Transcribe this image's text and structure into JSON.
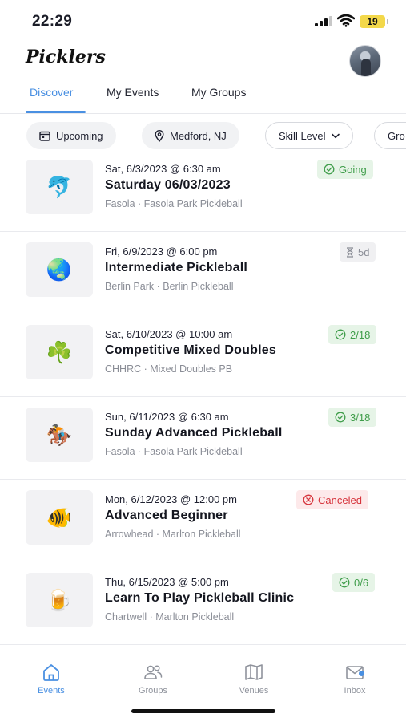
{
  "status_bar": {
    "time": "22:29",
    "battery": "19",
    "icons": [
      "signal-icon",
      "wifi-icon",
      "battery-icon"
    ],
    "battery_color": "#f3d84a"
  },
  "header": {
    "title": "Picklers",
    "avatar": "user-avatar"
  },
  "tabs": [
    {
      "label": "Discover",
      "active": true
    },
    {
      "label": "My Events",
      "active": false
    },
    {
      "label": "My Groups",
      "active": false
    }
  ],
  "filters": {
    "upcoming": "Upcoming",
    "location": "Medford, NJ",
    "skill": "Skill Level",
    "groups_partial": "Gro"
  },
  "events": [
    {
      "icon": "🐬",
      "date": "Sat, 6/3/2023 @ 6:30 am",
      "title": "Saturday 06/03/2023",
      "location": "Fasola · Fasola Park Pickleball",
      "badge": "Going",
      "badge_type": "green",
      "badge_icon": "check-circle-icon"
    },
    {
      "icon": "🌏",
      "date": "Fri, 6/9/2023 @ 6:00 pm",
      "title": "Intermediate Pickleball",
      "location": "Berlin Park  · Berlin Pickleball",
      "badge": "5d",
      "badge_type": "gray",
      "badge_icon": "hourglass-icon"
    },
    {
      "icon": "☘️",
      "date": "Sat, 6/10/2023 @ 10:00 am",
      "title": "Competitive Mixed Doubles",
      "location": "CHHRC · Mixed Doubles PB",
      "badge": "2/18",
      "badge_type": "green",
      "badge_icon": "check-circle-icon"
    },
    {
      "icon": "🏇",
      "date": "Sun, 6/11/2023 @ 6:30 am",
      "title": "Sunday Advanced Pickleball",
      "location": "Fasola · Fasola Park Pickleball",
      "badge": "3/18",
      "badge_type": "green",
      "badge_icon": "check-circle-icon"
    },
    {
      "icon": "🐠",
      "date": "Mon, 6/12/2023 @ 12:00 pm",
      "title": "Advanced Beginner",
      "location": "Arrowhead  · Marlton Pickleball",
      "badge": "Canceled",
      "badge_type": "red",
      "badge_icon": "x-circle-icon"
    },
    {
      "icon": "🍺",
      "date": "Thu, 6/15/2023 @ 5:00 pm",
      "title": "Learn To Play Pickleball Clinic",
      "location": "Chartwell  · Marlton Pickleball",
      "badge": "0/6",
      "badge_type": "green",
      "badge_icon": "check-circle-icon"
    }
  ],
  "bottom_nav": [
    {
      "label": "Events",
      "icon": "home-icon",
      "active": true
    },
    {
      "label": "Groups",
      "icon": "groups-icon",
      "active": false
    },
    {
      "label": "Venues",
      "icon": "map-icon",
      "active": false
    },
    {
      "label": "Inbox",
      "icon": "mail-icon",
      "active": false,
      "unread_dot": true
    }
  ],
  "colors": {
    "accent": "#4a90e2",
    "going_green": "#3f9d4a",
    "canceled_red": "#d6343c",
    "muted": "#8a8d96"
  }
}
